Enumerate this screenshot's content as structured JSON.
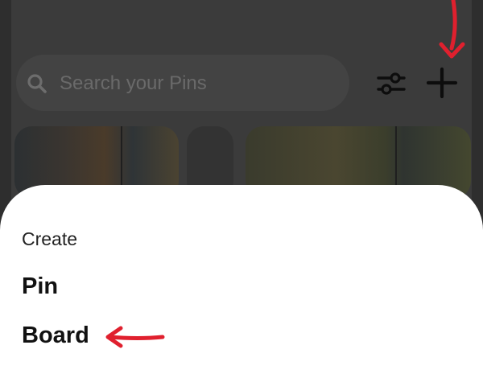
{
  "search": {
    "placeholder": "Search your Pins",
    "value": ""
  },
  "toolbar": {
    "filter_icon": "sliders-icon",
    "create_icon": "plus-icon"
  },
  "pins": [
    {
      "name": "pin-forest-1"
    },
    {
      "name": "pin-partial"
    },
    {
      "name": "pin-forest-2"
    }
  ],
  "sheet": {
    "title": "Create",
    "items": [
      {
        "label": "Pin"
      },
      {
        "label": "Board"
      }
    ]
  },
  "annotations": {
    "arrow_color": "#e0202e"
  }
}
